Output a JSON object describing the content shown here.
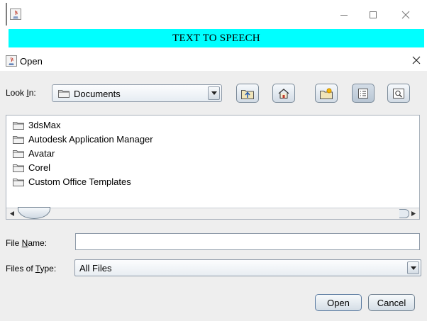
{
  "outer_window": {
    "banner_text": "TEXT TO SPEECH"
  },
  "dialog": {
    "title": "Open",
    "look_in": {
      "label_pre": "Look ",
      "label_mnemonic": "I",
      "label_post": "n:",
      "selected": "Documents"
    },
    "toolbar": [
      "up-one-level-icon",
      "home-icon",
      "new-folder-icon",
      "list-view-icon",
      "details-view-icon"
    ],
    "files": [
      {
        "name": "3dsMax"
      },
      {
        "name": "Autodesk Application Manager"
      },
      {
        "name": "Avatar"
      },
      {
        "name": "Corel"
      },
      {
        "name": "Custom Office Templates"
      }
    ],
    "file_name": {
      "label_pre": "File ",
      "label_mnemonic": "N",
      "label_post": "ame:",
      "value": ""
    },
    "files_of_type": {
      "label_pre": "Files of ",
      "label_mnemonic": "T",
      "label_post": "ype:",
      "selected": "All Files"
    },
    "buttons": {
      "open": "Open",
      "cancel": "Cancel"
    }
  },
  "colors": {
    "banner": "#00ffff",
    "dialog_bg": "#eeeeee"
  }
}
